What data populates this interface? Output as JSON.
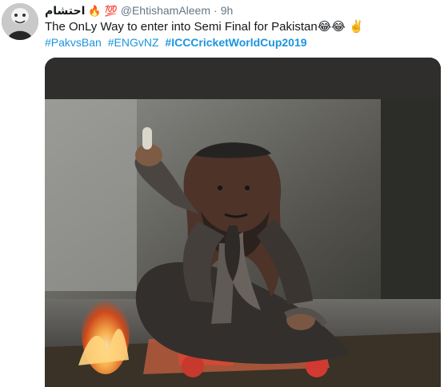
{
  "tweet": {
    "author_name": "احتشام",
    "author_emojis": [
      "🔥",
      "💯"
    ],
    "handle": "@EhtishamAleem",
    "separator": "·",
    "time": "9h",
    "text": "The OnLy Way to enter into Semi Final for Pakistan",
    "text_emojis": [
      "😂",
      "😂",
      "✌️"
    ],
    "hashtags": [
      "#PakvsBan",
      "#ENGvNZ",
      "#ICCCricketWorldCup2019"
    ],
    "bold_hashtag_index": 2
  },
  "media": {
    "kind": "photo",
    "icon": "photo-man-by-fire"
  },
  "colors": {
    "link": "#1b95e0",
    "secondary_text": "#657786",
    "primary_text": "#14171a"
  }
}
